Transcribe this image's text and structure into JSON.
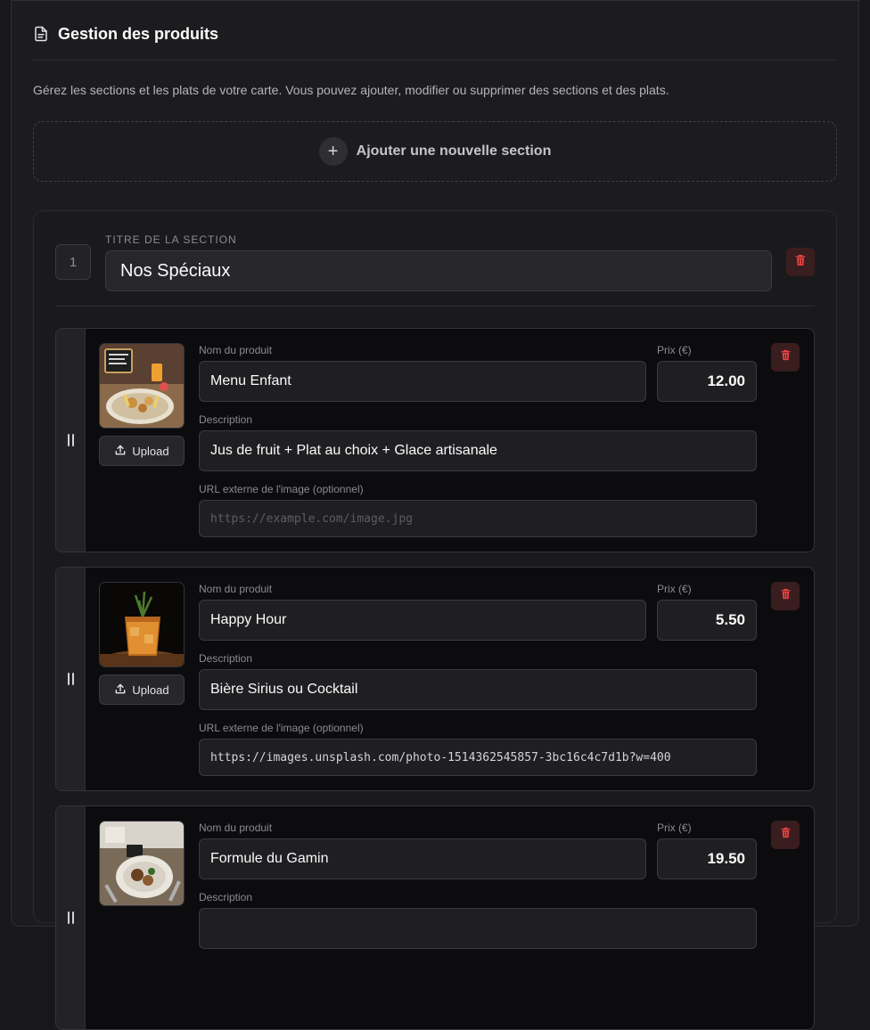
{
  "header": {
    "icon": "document-icon",
    "title": "Gestion des produits",
    "description": "Gérez les sections et les plats de votre carte. Vous pouvez ajouter, modifier ou supprimer des sections et des plats."
  },
  "add_section": {
    "icon": "plus-icon",
    "label": "Ajouter une nouvelle section"
  },
  "section": {
    "number": "1",
    "title_label": "TITRE DE LA SECTION",
    "title_value": "Nos Spéciaux"
  },
  "labels": {
    "name": "Nom du produit",
    "price": "Prix (€)",
    "description": "Description",
    "url": "URL externe de l'image (optionnel)",
    "upload": "Upload"
  },
  "products": [
    {
      "name": "Menu Enfant",
      "price": "12.00",
      "description": "Jus de fruit + Plat au choix + Glace artisanale",
      "url": "",
      "url_placeholder": "https://example.com/image.jpg"
    },
    {
      "name": "Happy Hour",
      "price": "5.50",
      "description": "Bière Sirius ou Cocktail",
      "url": "https://images.unsplash.com/photo-1514362545857-3bc16c4c7d1b?w=400",
      "url_placeholder": "https://example.com/image.jpg"
    },
    {
      "name": "Formule du Gamin",
      "price": "19.50",
      "description": "",
      "url": "",
      "url_placeholder": "https://example.com/image.jpg"
    }
  ],
  "colors": {
    "background": "#18181b",
    "panel": "#1c1c1f",
    "danger": "#ef4444",
    "danger_bg": "#3a1d1f"
  }
}
